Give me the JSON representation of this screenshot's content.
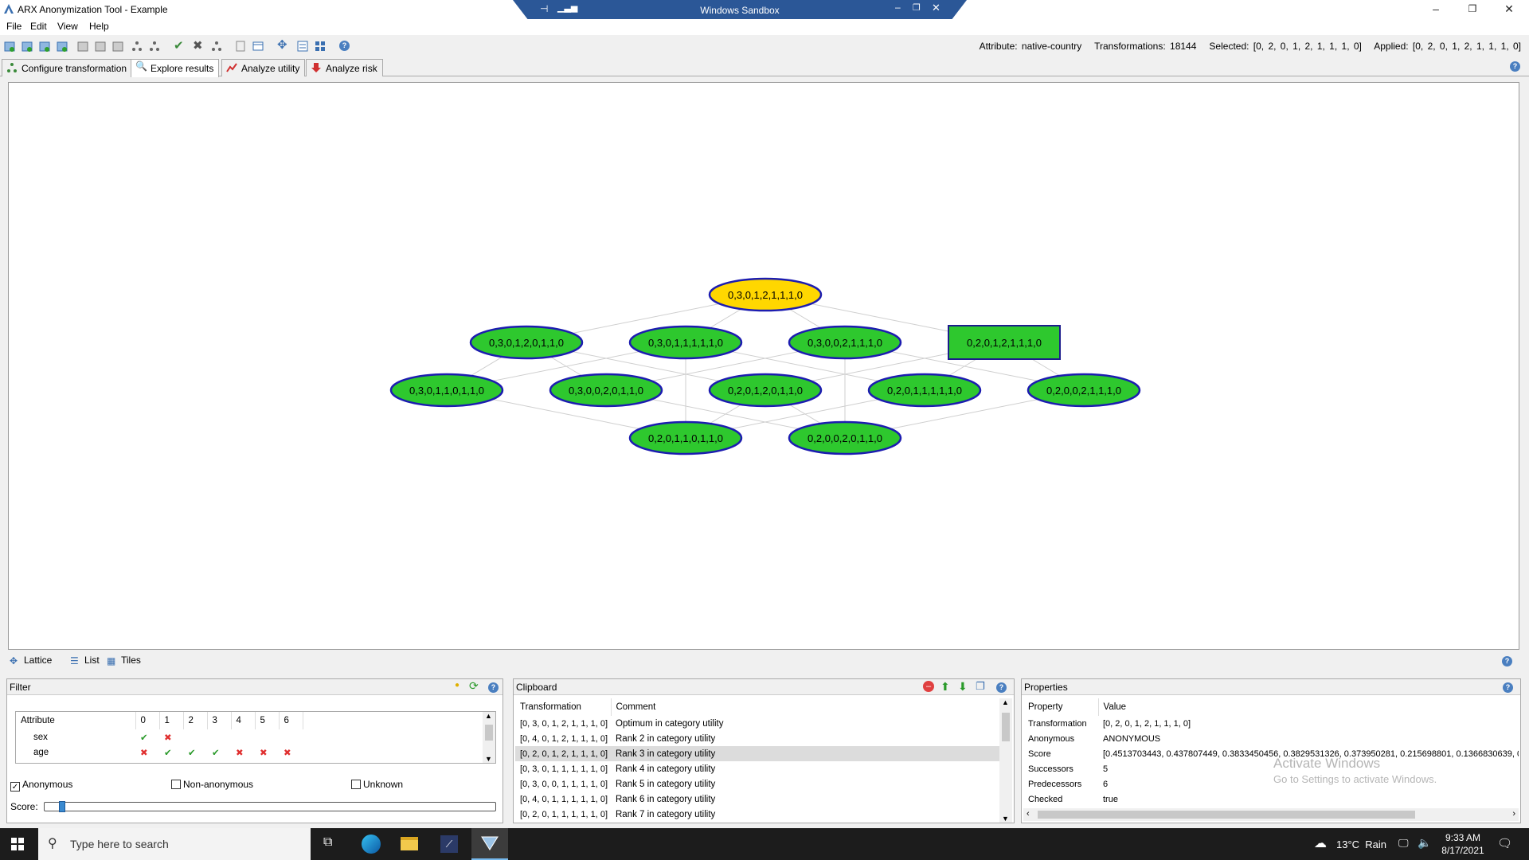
{
  "window": {
    "title": "ARX Anonymization Tool - Example",
    "sandbox_title": "Windows Sandbox"
  },
  "menu": [
    "File",
    "Edit",
    "View",
    "Help"
  ],
  "status": {
    "attribute": "Attribute: native-country",
    "transformations": "Transformations: 18144",
    "selected": "Selected: [0, 2, 0, 1, 2, 1, 1, 1, 0]",
    "applied": "Applied: [0, 2, 0, 1, 2, 1, 1, 1, 0]"
  },
  "tabs": [
    "Configure transformation",
    "Explore results",
    "Analyze utility",
    "Analyze risk"
  ],
  "lattice": {
    "nodes": [
      {
        "label": "0,3,0,1,2,1,1,1,0",
        "color": "#ffd700",
        "shape": "ellipse"
      },
      {
        "label": "0,3,0,1,2,0,1,1,0",
        "color": "#2ec82e",
        "shape": "ellipse"
      },
      {
        "label": "0,3,0,1,1,1,1,1,0",
        "color": "#2ec82e",
        "shape": "ellipse"
      },
      {
        "label": "0,3,0,0,2,1,1,1,0",
        "color": "#2ec82e",
        "shape": "ellipse"
      },
      {
        "label": "0,2,0,1,2,1,1,1,0",
        "color": "#2ec82e",
        "shape": "rect"
      },
      {
        "label": "0,3,0,1,1,0,1,1,0",
        "color": "#2ec82e",
        "shape": "ellipse"
      },
      {
        "label": "0,3,0,0,2,0,1,1,0",
        "color": "#2ec82e",
        "shape": "ellipse"
      },
      {
        "label": "0,2,0,1,2,0,1,1,0",
        "color": "#2ec82e",
        "shape": "ellipse"
      },
      {
        "label": "0,2,0,1,1,1,1,1,0",
        "color": "#2ec82e",
        "shape": "ellipse"
      },
      {
        "label": "0,2,0,0,2,1,1,1,0",
        "color": "#2ec82e",
        "shape": "ellipse"
      },
      {
        "label": "0,2,0,1,1,0,1,1,0",
        "color": "#2ec82e",
        "shape": "ellipse"
      },
      {
        "label": "0,2,0,0,2,0,1,1,0",
        "color": "#2ec82e",
        "shape": "ellipse"
      }
    ]
  },
  "view_tabs": [
    "Lattice",
    "List",
    "Tiles"
  ],
  "filter": {
    "title": "Filter",
    "header": [
      "Attribute",
      "0",
      "1",
      "2",
      "3",
      "4",
      "5",
      "6"
    ],
    "rows": [
      {
        "name": "sex",
        "marks": [
          "check",
          "cross",
          "",
          "",
          "",
          "",
          ""
        ]
      },
      {
        "name": "age",
        "marks": [
          "cross",
          "check",
          "check",
          "check",
          "cross",
          "cross",
          "cross"
        ]
      }
    ],
    "checkboxes": [
      {
        "label": "Anonymous",
        "checked": true
      },
      {
        "label": "Non-anonymous",
        "checked": false
      },
      {
        "label": "Unknown",
        "checked": false
      }
    ],
    "score_label": "Score:"
  },
  "clipboard": {
    "title": "Clipboard",
    "header": [
      "Transformation",
      "Comment"
    ],
    "rows": [
      [
        "[0, 3, 0, 1, 2, 1, 1, 1, 0]",
        "Optimum in category utility"
      ],
      [
        "[0, 4, 0, 1, 2, 1, 1, 1, 0]",
        "Rank 2 in category utility"
      ],
      [
        "[0, 2, 0, 1, 2, 1, 1, 1, 0]",
        "Rank 3 in category utility"
      ],
      [
        "[0, 3, 0, 1, 1, 1, 1, 1, 0]",
        "Rank 4 in category utility"
      ],
      [
        "[0, 3, 0, 0, 1, 1, 1, 1, 0]",
        "Rank 5 in category utility"
      ],
      [
        "[0, 4, 0, 1, 1, 1, 1, 1, 0]",
        "Rank 6 in category utility"
      ],
      [
        "[0, 2, 0, 1, 1, 1, 1, 1, 0]",
        "Rank 7 in category utility"
      ]
    ],
    "selected_row": 2
  },
  "properties": {
    "title": "Properties",
    "header": [
      "Property",
      "Value"
    ],
    "rows": [
      [
        "Transformation",
        "[0, 2, 0, 1, 2, 1, 1, 1, 0]"
      ],
      [
        "Anonymous",
        "ANONYMOUS"
      ],
      [
        "Score",
        "[0.4513703443, 0.437807449, 0.3833450456, 0.3829531326, 0.373950281, 0.215698801, 0.1366830639, 0.1"
      ],
      [
        "Successors",
        "5"
      ],
      [
        "Predecessors",
        "6"
      ],
      [
        "Checked",
        "true"
      ]
    ],
    "watermark_line1": "Activate Windows",
    "watermark_line2": "Go to Settings to activate Windows."
  },
  "taskbar": {
    "search_placeholder": "Type here to search",
    "weather": "13°C  Rain",
    "time": "9:33 AM",
    "date": "8/17/2021"
  }
}
